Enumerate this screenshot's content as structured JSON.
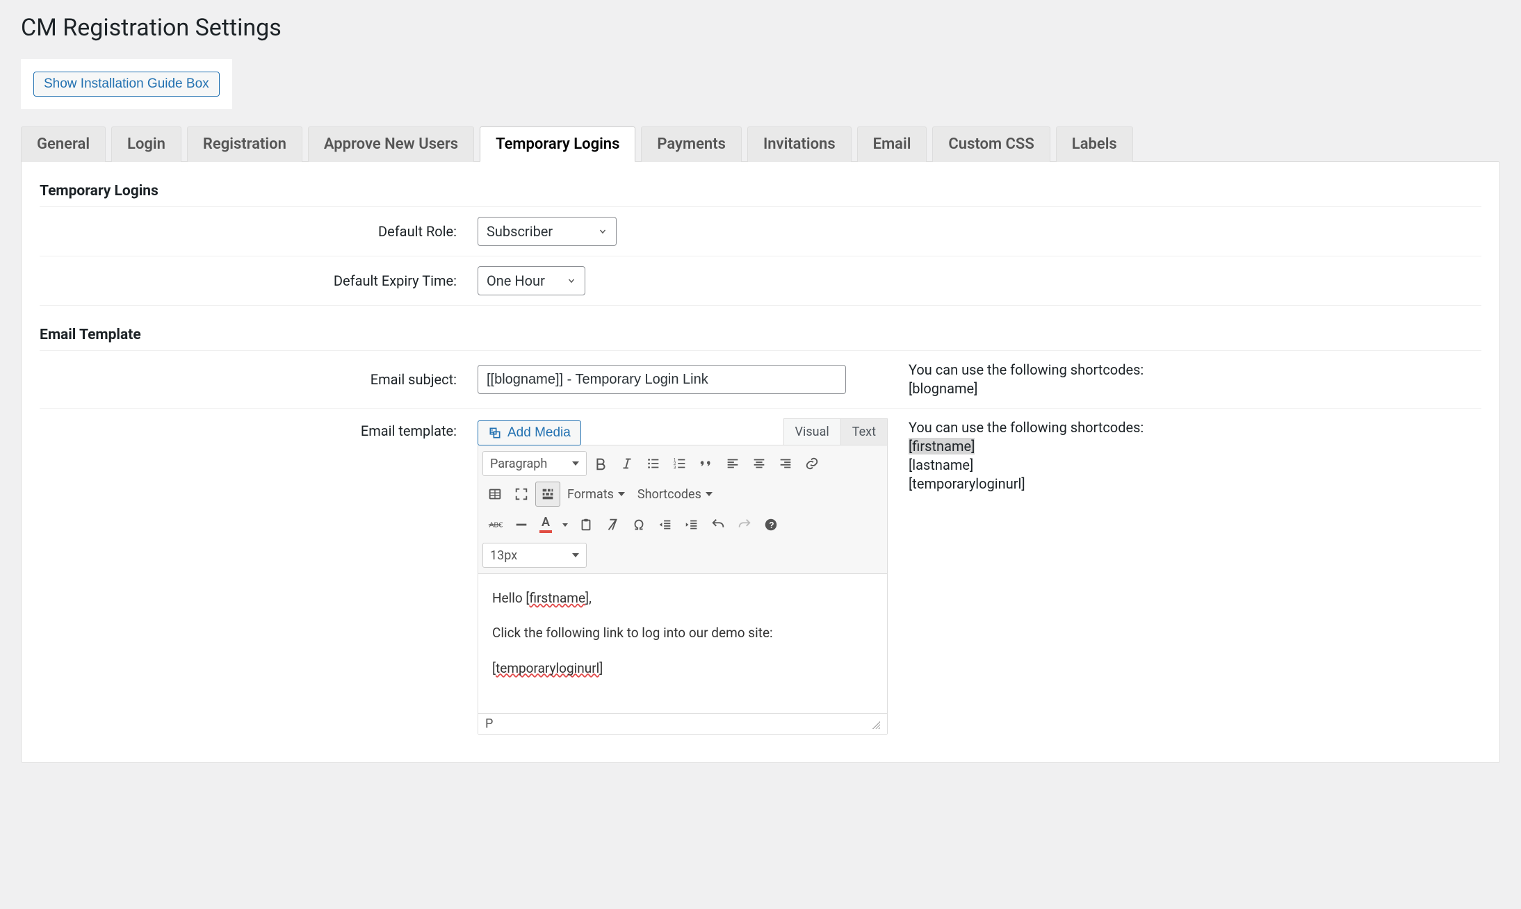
{
  "page_title": "CM Registration Settings",
  "guide_button": "Show Installation Guide Box",
  "tabs": [
    "General",
    "Login",
    "Registration",
    "Approve New Users",
    "Temporary Logins",
    "Payments",
    "Invitations",
    "Email",
    "Custom CSS",
    "Labels"
  ],
  "active_tab_index": 4,
  "section_temporary_logins": {
    "title": "Temporary Logins",
    "rows": {
      "default_role": {
        "label": "Default Role:",
        "value": "Subscriber"
      },
      "default_expiry": {
        "label": "Default Expiry Time:",
        "value": "One Hour"
      }
    }
  },
  "section_email_template": {
    "title": "Email Template",
    "rows": {
      "email_subject": {
        "label": "Email subject:",
        "value": "[[blogname]] - Temporary Login Link",
        "help_intro": "You can use the following shortcodes:",
        "help_codes": [
          "[blogname]"
        ]
      },
      "email_template": {
        "label": "Email template:",
        "add_media": "Add Media",
        "mode_visual": "Visual",
        "mode_text": "Text",
        "help_intro": "You can use the following shortcodes:",
        "help_codes": [
          "[firstname]",
          "[lastname]",
          "[temporaryloginurl]"
        ],
        "paragraph_select": "Paragraph",
        "formats_label": "Formats",
        "shortcodes_label": "Shortcodes",
        "fontsize_select": "13px",
        "body": {
          "line1_pre": "Hello [",
          "line1_err": "firstname",
          "line1_post": "],",
          "line2": "Click the following link to log into our demo site:",
          "line3_pre": "[",
          "line3_err": "temporaryloginurl",
          "line3_post": "]"
        },
        "status_path": "P"
      }
    }
  }
}
